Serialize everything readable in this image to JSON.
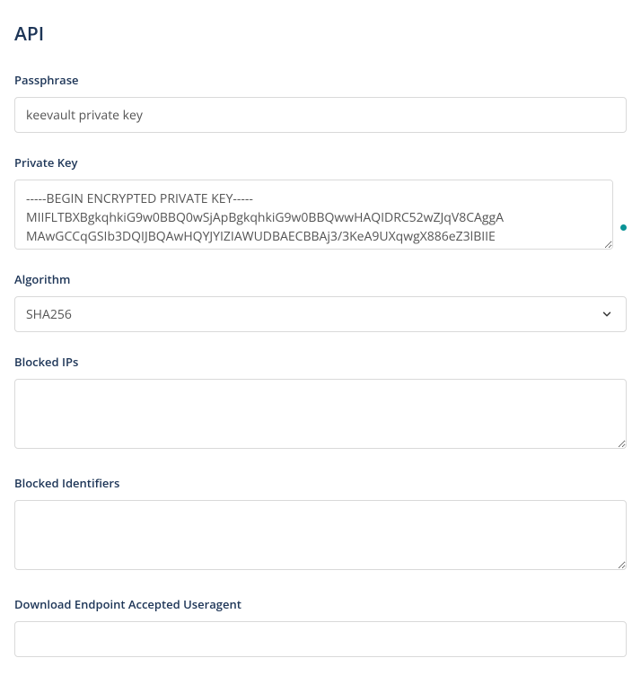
{
  "page": {
    "title": "API"
  },
  "fields": {
    "passphrase": {
      "label": "Passphrase",
      "value": "keevault private key"
    },
    "private_key": {
      "label": "Private Key",
      "value": "-----BEGIN ENCRYPTED PRIVATE KEY-----\nMIIFLTBXBgkqhkiG9w0BBQ0wSjApBgkqhkiG9w0BBQwwHAQIDRC52wZJqV8CAggA\nMAwGCCqGSIb3DQIJBQAwHQYJYIZIAWUDBAECBBAj3/3KeA9UXqwgX886eZ3lBIIE"
    },
    "algorithm": {
      "label": "Algorithm",
      "selected": "SHA256"
    },
    "blocked_ips": {
      "label": "Blocked IPs",
      "value": ""
    },
    "blocked_identifiers": {
      "label": "Blocked Identifiers",
      "value": ""
    },
    "download_useragent": {
      "label": "Download Endpoint Accepted Useragent",
      "value": ""
    }
  }
}
